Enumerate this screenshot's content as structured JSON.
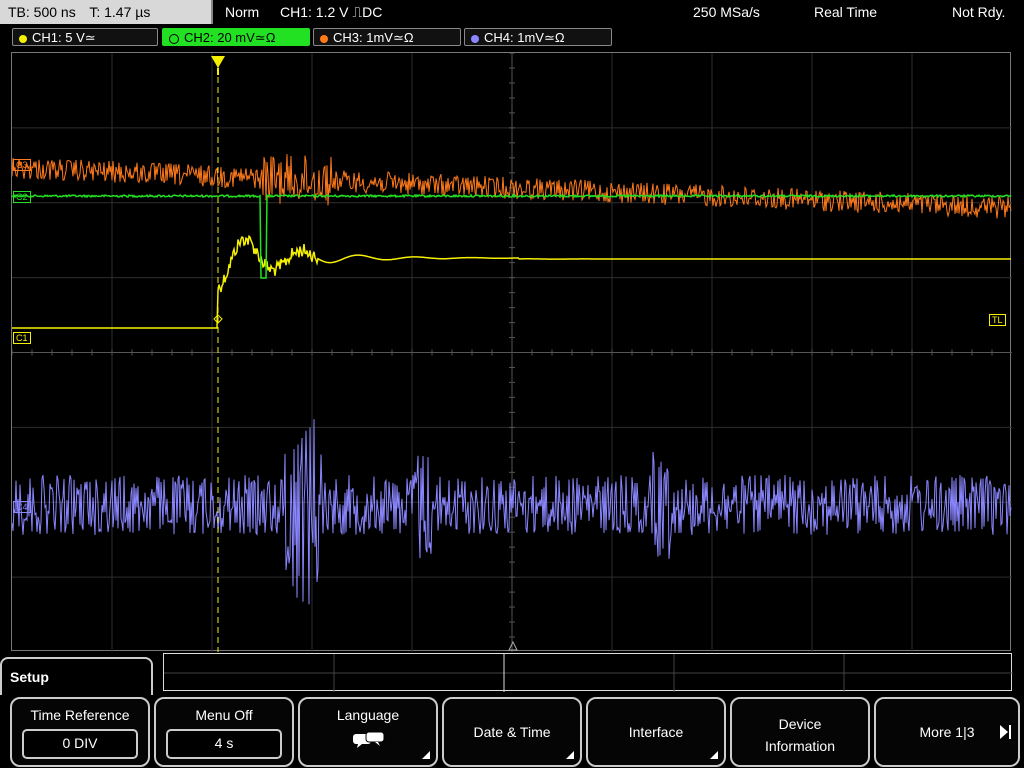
{
  "status_bar": {
    "timebase": "TB: 500 ns",
    "trigger_time": "T: 1.47 µs",
    "trigger_mode": "Norm",
    "trigger_setting": "CH1: 1.2 V ⎍DC",
    "sample_rate": "250 MSa/s",
    "acq_mode": "Real Time",
    "status": "Not Rdy."
  },
  "channels": [
    {
      "label": "CH1: 5 V≃",
      "color": "#f5f000"
    },
    {
      "label": "CH2: 20 mV≃Ω",
      "color": "#22e022"
    },
    {
      "label": "CH3: 1mV≃Ω",
      "color": "#ff7a1a"
    },
    {
      "label": "CH4: 1mV≃Ω",
      "color": "#8a86ff"
    }
  ],
  "markers": {
    "c1": "C1",
    "c2": "C2",
    "c3": "C3",
    "c4": "C4",
    "trigger_level": "TL"
  },
  "setup_tab": "Setup",
  "softkeys": {
    "time_reference": {
      "title": "Time Reference",
      "value": "0 DIV"
    },
    "menu_off": {
      "title": "Menu Off",
      "value": "4 s"
    },
    "language": {
      "title": "Language"
    },
    "date_time": {
      "title": "Date & Time"
    },
    "interface": {
      "title": "Interface"
    },
    "device_information": {
      "line1": "Device",
      "line2": "Information"
    },
    "more": {
      "title": "More 1|3"
    }
  },
  "icons": {
    "language": "speech-bubbles-icon",
    "trigger_position": "trigger-marker-icon"
  }
}
